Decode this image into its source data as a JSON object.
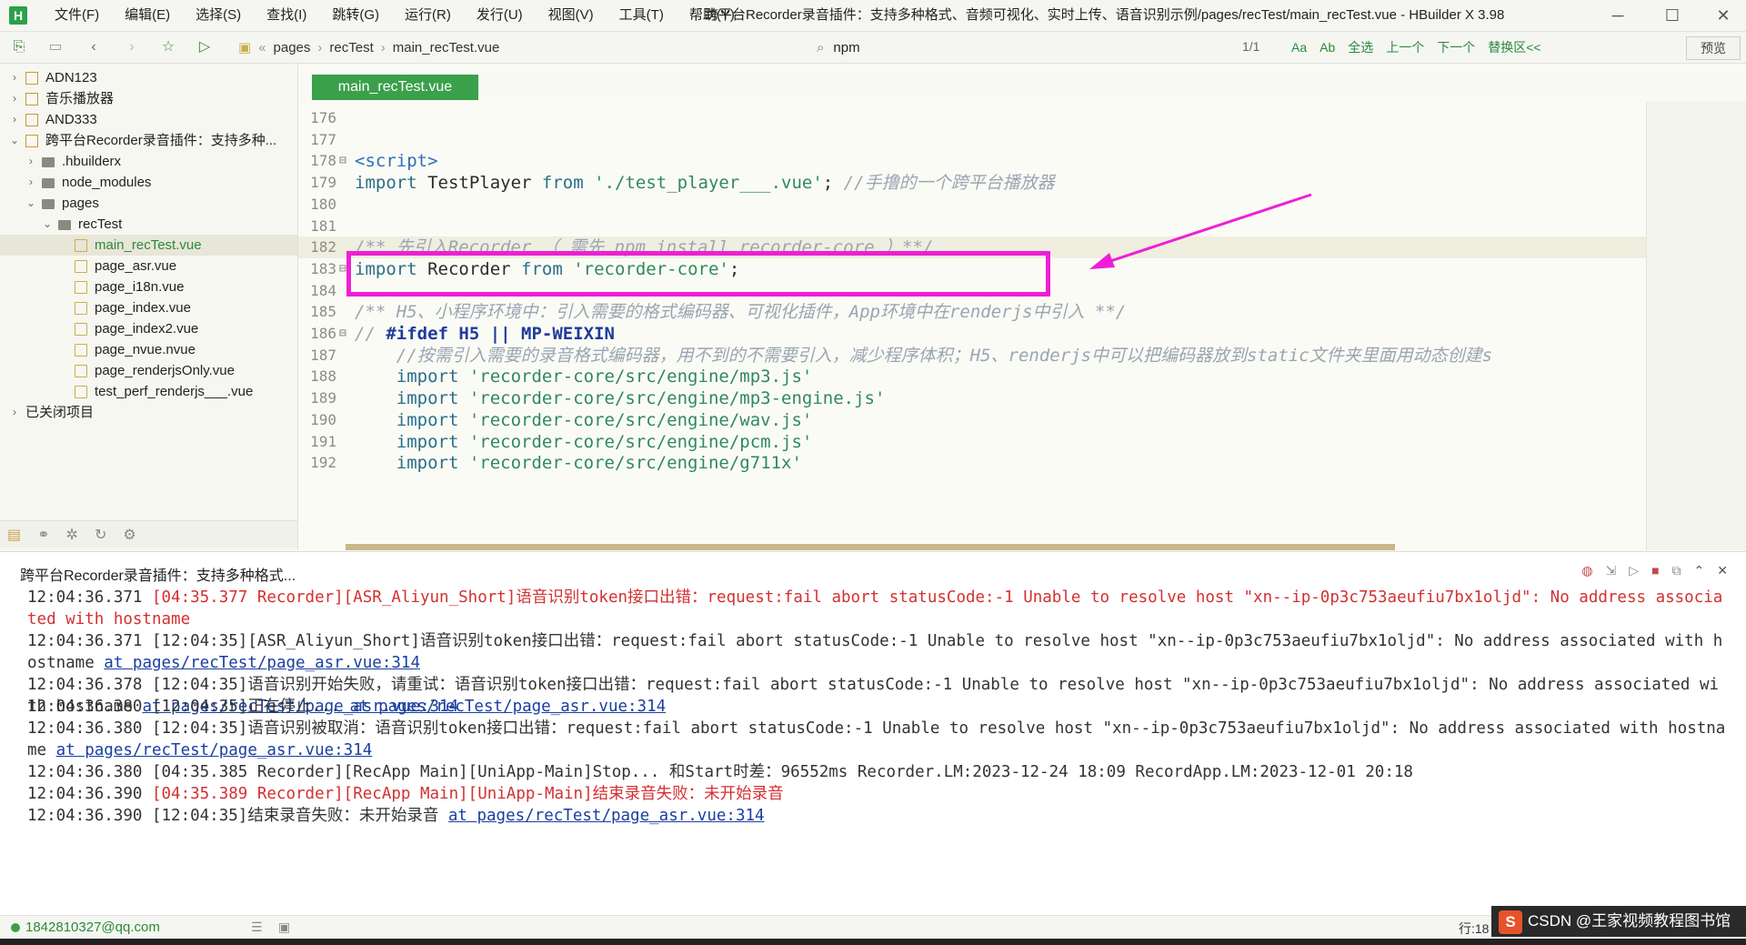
{
  "menubar": {
    "app_logo": "H",
    "items": [
      "文件(F)",
      "编辑(E)",
      "选择(S)",
      "查找(I)",
      "跳转(G)",
      "运行(R)",
      "发行(U)",
      "视图(V)",
      "工具(T)",
      "帮助(Y)"
    ],
    "window_title": "跨平台Recorder录音插件：支持多种格式、音频可视化、实时上传、语音识别示例/pages/recTest/main_recTest.vue - HBuilder X 3.98"
  },
  "toolbar": {
    "breadcrumb": [
      "pages",
      "recTest",
      "main_recTest.vue"
    ],
    "find_value": "npm",
    "find_count": "1/1",
    "find_tools": [
      "Aa",
      "Ab",
      "全选",
      "上一个",
      "下一个",
      "替换区<<"
    ],
    "preview_label": "预览"
  },
  "sidebar": {
    "items": [
      {
        "label": "ADN123",
        "type": "project",
        "level": 0,
        "arrow": "›"
      },
      {
        "label": "音乐播放器",
        "type": "project",
        "level": 0,
        "arrow": "›"
      },
      {
        "label": "AND333",
        "type": "project",
        "level": 0,
        "arrow": "›"
      },
      {
        "label": "跨平台Recorder录音插件：支持多种...",
        "type": "project",
        "level": 0,
        "arrow": "⌄"
      },
      {
        "label": ".hbuilderx",
        "type": "folder",
        "level": 1,
        "arrow": "›"
      },
      {
        "label": "node_modules",
        "type": "folder",
        "level": 1,
        "arrow": "›"
      },
      {
        "label": "pages",
        "type": "folder",
        "level": 1,
        "arrow": "⌄"
      },
      {
        "label": "recTest",
        "type": "folder",
        "level": 2,
        "arrow": "⌄"
      },
      {
        "label": "main_recTest.vue",
        "type": "vue",
        "level": 3,
        "arrow": "",
        "selected": true
      },
      {
        "label": "page_asr.vue",
        "type": "vue",
        "level": 3,
        "arrow": ""
      },
      {
        "label": "page_i18n.vue",
        "type": "vue",
        "level": 3,
        "arrow": ""
      },
      {
        "label": "page_index.vue",
        "type": "vue",
        "level": 3,
        "arrow": ""
      },
      {
        "label": "page_index2.vue",
        "type": "vue",
        "level": 3,
        "arrow": ""
      },
      {
        "label": "page_nvue.nvue",
        "type": "vue",
        "level": 3,
        "arrow": ""
      },
      {
        "label": "page_renderjsOnly.vue",
        "type": "vue",
        "level": 3,
        "arrow": ""
      },
      {
        "label": "test_perf_renderjs___.vue",
        "type": "vue",
        "level": 3,
        "arrow": ""
      },
      {
        "label": "已关闭项目",
        "type": "none",
        "level": 0,
        "arrow": "›"
      }
    ]
  },
  "editor": {
    "tab_label": "main_recTest.vue",
    "lines": [
      {
        "num": "176",
        "fold": "",
        "parts": []
      },
      {
        "num": "177",
        "fold": "",
        "parts": []
      },
      {
        "num": "178",
        "fold": "⊟",
        "parts": [
          {
            "t": "<script>",
            "c": "c-tag"
          }
        ]
      },
      {
        "num": "179",
        "fold": "",
        "parts": [
          {
            "t": "import ",
            "c": "c-kw"
          },
          {
            "t": "TestPlayer ",
            "c": "c-plain"
          },
          {
            "t": "from ",
            "c": "c-kw"
          },
          {
            "t": "'./test_player___.vue'",
            "c": "c-str"
          },
          {
            "t": "; ",
            "c": "c-plain"
          },
          {
            "t": "//手撸的一个跨平台播放器",
            "c": "c-cmt"
          }
        ]
      },
      {
        "num": "180",
        "fold": "",
        "parts": []
      },
      {
        "num": "181",
        "fold": "",
        "parts": []
      },
      {
        "num": "182",
        "fold": "",
        "current": true,
        "parts": [
          {
            "t": "/** 先引入Recorder （ 需先 npm install recorder-core ）**/",
            "c": "c-cmt"
          }
        ]
      },
      {
        "num": "183",
        "fold": "⊟",
        "parts": [
          {
            "t": "import ",
            "c": "c-kw"
          },
          {
            "t": "Recorder ",
            "c": "c-plain"
          },
          {
            "t": "from ",
            "c": "c-kw"
          },
          {
            "t": "'recorder-core'",
            "c": "c-str"
          },
          {
            "t": ";",
            "c": "c-plain"
          }
        ]
      },
      {
        "num": "184",
        "fold": "",
        "parts": []
      },
      {
        "num": "185",
        "fold": "",
        "parts": [
          {
            "t": "/** H5、小程序环境中：引入需要的格式编码器、可视化插件，App环境中在renderjs中引入 **/",
            "c": "c-cmt"
          }
        ]
      },
      {
        "num": "186",
        "fold": "⊟",
        "parts": [
          {
            "t": "// ",
            "c": "c-cmt"
          },
          {
            "t": "#ifdef H5 || MP-WEIXIN",
            "c": "c-dir"
          }
        ]
      },
      {
        "num": "187",
        "fold": "",
        "parts": [
          {
            "t": "    //按需引入需要的录音格式编码器，用不到的不需要引入，减少程序体积；H5、renderjs中可以把编码器放到static文件夹里面用动态创建s",
            "c": "c-cmt"
          }
        ]
      },
      {
        "num": "188",
        "fold": "",
        "parts": [
          {
            "t": "    import ",
            "c": "c-kw"
          },
          {
            "t": "'recorder-core/src/engine/mp3.js'",
            "c": "c-str"
          }
        ]
      },
      {
        "num": "189",
        "fold": "",
        "parts": [
          {
            "t": "    import ",
            "c": "c-kw"
          },
          {
            "t": "'recorder-core/src/engine/mp3-engine.js'",
            "c": "c-str"
          }
        ]
      },
      {
        "num": "190",
        "fold": "",
        "parts": [
          {
            "t": "    import ",
            "c": "c-kw"
          },
          {
            "t": "'recorder-core/src/engine/wav.js'",
            "c": "c-str"
          }
        ]
      },
      {
        "num": "191",
        "fold": "",
        "parts": [
          {
            "t": "    import ",
            "c": "c-kw"
          },
          {
            "t": "'recorder-core/src/engine/pcm.js'",
            "c": "c-str"
          }
        ]
      },
      {
        "num": "192",
        "fold": "",
        "parts": [
          {
            "t": "    import ",
            "c": "c-kw"
          },
          {
            "t": "'recorder-core/src/engine/g711x'",
            "c": "c-str"
          }
        ]
      }
    ]
  },
  "console": {
    "title": "跨平台Recorder录音插件：支持多种格式...",
    "lines": [
      {
        "parts": [
          {
            "t": "12:04:36.371 ",
            "c": ""
          },
          {
            "t": "[04:35.377 Recorder][ASR_Aliyun_Short]语音识别token接口出错：request:fail abort statusCode:-1 Unable to resolve host \"xn--ip-0p3c753aeufiu7bx1oljd\": No address associated with hostname",
            "c": "log-red"
          }
        ]
      },
      {
        "parts": [
          {
            "t": "12:04:36.371 [12:04:35][ASR_Aliyun_Short]语音识别token接口出错：request:fail abort statusCode:-1 Unable to resolve host \"xn--ip-0p3c753aeufiu7bx1oljd\": No address associated with hostname ",
            "c": ""
          },
          {
            "t": "at pages/recTest/page_asr.vue:314",
            "c": "log-link"
          }
        ]
      },
      {
        "parts": [
          {
            "t": "12:04:36.378 [12:04:35]语音识别开始失败，请重试：语音识别token接口出错：request:fail abort statusCode:-1 Unable to resolve host \"xn--ip-0p3c753aeufiu7bx1oljd\": No address associated with hostname ",
            "c": ""
          },
          {
            "t": "at pages/recTest/page_asr.vue:314",
            "c": "log-link"
          }
        ]
      },
      {
        "parts": [
          {
            "t": "12:04:36.380 [12:04:35]正在停止... ",
            "c": ""
          },
          {
            "t": "at pages/recTest/page_asr.vue:314",
            "c": "log-link"
          }
        ]
      },
      {
        "parts": [
          {
            "t": "12:04:36.380 [12:04:35]语音识别被取消：语音识别token接口出错：request:fail abort statusCode:-1 Unable to resolve host \"xn--ip-0p3c753aeufiu7bx1oljd\": No address associated with hostname ",
            "c": ""
          },
          {
            "t": "at pages/recTest/page_asr.vue:314",
            "c": "log-link"
          }
        ]
      },
      {
        "parts": [
          {
            "t": "12:04:36.380 [04:35.385 Recorder][RecApp Main][UniApp-Main]Stop... 和Start时差：96552ms Recorder.LM:2023-12-24 18:09 RecordApp.LM:2023-12-01 20:18",
            "c": ""
          }
        ]
      },
      {
        "parts": [
          {
            "t": "12:04:36.390 ",
            "c": ""
          },
          {
            "t": "[04:35.389 Recorder][RecApp Main][UniApp-Main]结束录音失败：未开始录音",
            "c": "log-red"
          }
        ]
      },
      {
        "parts": [
          {
            "t": "12:04:36.390 [12:04:35]结束录音失败：未开始录音 ",
            "c": ""
          },
          {
            "t": "at pages/recTest/page_asr.vue:314",
            "c": "log-link"
          }
        ]
      }
    ]
  },
  "statusbar": {
    "email": "1842810327@qq.com",
    "position": "行:18"
  },
  "watermark": {
    "logo": "S",
    "text": "CSDN @王家视频教程图书馆"
  },
  "colors": {
    "accent": "#3aa04a",
    "highlight": "#ee1fd6",
    "error": "#d43030"
  }
}
